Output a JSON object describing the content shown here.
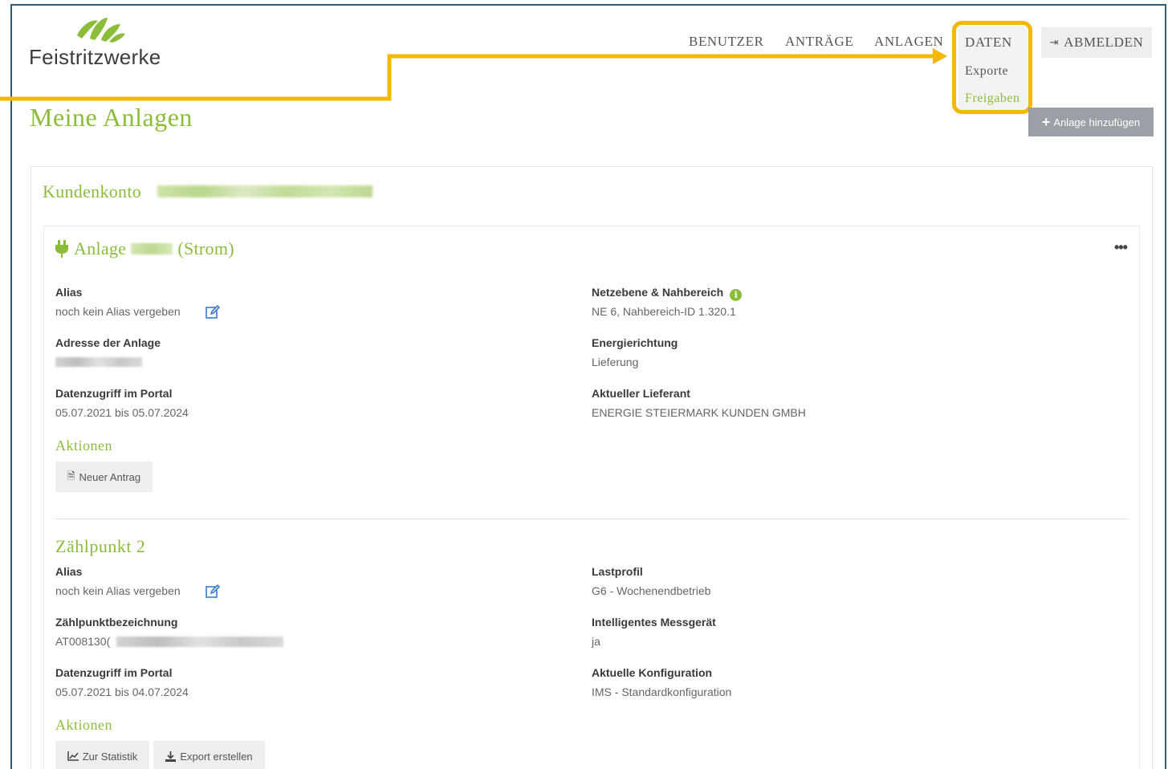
{
  "brand": {
    "name": "Feistritzwerke",
    "color": "#8bbd3a"
  },
  "nav": {
    "benutzer": "BENUTZER",
    "antraege": "ANTRÄGE",
    "anlagen": "ANLAGEN",
    "daten": "DATEN",
    "daten_menu": [
      "Exporte",
      "Freigaben"
    ],
    "logout": "ABMELDEN",
    "logout_icon": "sign-out-icon"
  },
  "page": {
    "title": "Meine Anlagen",
    "add_button": "Anlage hinzufügen"
  },
  "account": {
    "label": "Kundenkonto"
  },
  "anlage": {
    "prefix": "Anlage",
    "suffix": "(Strom)",
    "alias_label": "Alias",
    "alias_value": "noch kein Alias vergeben",
    "address_label": "Adresse der Anlage",
    "access_label": "Datenzugriff im Portal",
    "access_value": "05.07.2021 bis 05.07.2024",
    "netz_label": "Netzebene & Nahbereich",
    "netz_value": "NE 6, Nahbereich-ID 1.320.1",
    "energy_label": "Energierichtung",
    "energy_value": "Lieferung",
    "supplier_label": "Aktueller Lieferant",
    "supplier_value": "ENERGIE STEIERMARK KUNDEN GMBH",
    "actions_heading": "Aktionen",
    "new_request": "Neuer Antrag"
  },
  "zaehlpunkt": {
    "heading": "Zählpunkt 2",
    "alias_label": "Alias",
    "alias_value": "noch kein Alias vergeben",
    "designation_label": "Zählpunktbezeichnung",
    "designation_value": "AT008130(",
    "access_label": "Datenzugriff im Portal",
    "access_value": "05.07.2021 bis 04.07.2024",
    "profile_label": "Lastprofil",
    "profile_value": "G6 - Wochenendbetrieb",
    "meter_label": "Intelligentes Messgerät",
    "meter_value": "ja",
    "config_label": "Aktuelle Konfiguration",
    "config_value": "IMS - Standardkonfiguration",
    "actions_heading": "Aktionen",
    "stats_button": "Zur Statistik",
    "export_button": "Export erstellen"
  },
  "colors": {
    "accent": "#8bbd3a",
    "highlight": "#f5b800",
    "frame": "#2f5f7a"
  }
}
